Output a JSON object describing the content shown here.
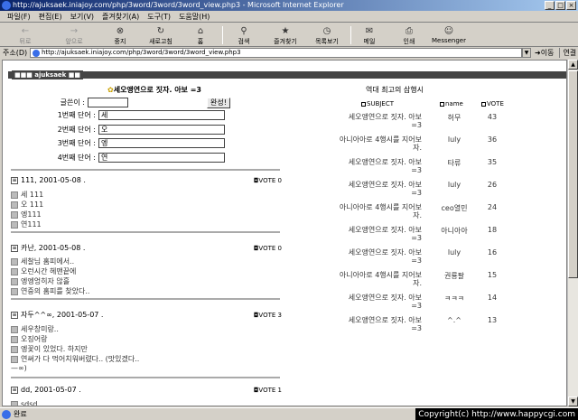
{
  "window": {
    "title": "http://ajuksaek.iniajoy.com/php/3word/3word/3word_view.php3 - Microsoft Internet Explorer"
  },
  "menu": [
    "파일(F)",
    "편집(E)",
    "보기(V)",
    "즐겨찾기(A)",
    "도구(T)",
    "도움말(H)"
  ],
  "toolbar": {
    "back": "뒤로",
    "forward": "앞으로",
    "stop": "중지",
    "refresh": "새로고침",
    "home": "홈",
    "search": "검색",
    "favorites": "즐겨찾기",
    "history": "목록보기",
    "mail": "메일",
    "print": "인쇄",
    "messenger": "Messenger"
  },
  "address": {
    "label": "주소(D)",
    "url": "http://ajuksaek.iniajoy.com/php/3word/3word/3word_view.php3",
    "go": "이동",
    "links": "연결"
  },
  "page": {
    "brand": "ajuksaek",
    "title": "세오앵연으로 짓자. 아보 =3",
    "form": {
      "author_label": "글쓴이 :",
      "author_value": "",
      "word1_label": "1번째 단어 :",
      "word1_value": "세",
      "word2_label": "2번째 단어 :",
      "word2_value": "오",
      "word3_label": "3번째 단어 :",
      "word3_value": "엥",
      "word4_label": "4번째 단어 :",
      "word4_value": "연",
      "submit": "완성!"
    },
    "entries": [
      {
        "header": "111, 2001-05-08 .",
        "vote_label": "VOTE",
        "votes": "0",
        "lines": [
          "세 111",
          "오 111",
          "엥111",
          "연111"
        ]
      },
      {
        "header": "카난, 2001-05-08 .",
        "vote_label": "VOTE",
        "votes": "0",
        "lines": [
          "세찰님 홈피에서..",
          "오런시간 헤맨끝에",
          "엥엥엉히자 않흘",
          "연중의 홈피를 찾았다.."
        ]
      },
      {
        "header": "자두^^∞, 2001-05-07 .",
        "vote_label": "VOTE",
        "votes": "3",
        "lines": [
          "세우창미랑..",
          "오징어랑",
          "엥꽃이 있었다. 하지만",
          "연써가 다 먹어치워버렸다.. (맛있겠다..",
          "—∞)"
        ]
      },
      {
        "header": "dd, 2001-05-07 .",
        "vote_label": "VOTE",
        "votes": "1",
        "lines": [
          "sdsd"
        ]
      }
    ],
    "ranking": {
      "title": "역대 최고의 삼행시",
      "headers": {
        "subject": "SUBJECT",
        "name": "name",
        "vote": "VOTE"
      },
      "rows": [
        {
          "subject": "세오앵연으로 짓자. 아보 =3",
          "name": "허무",
          "vote": "43"
        },
        {
          "subject": "아니아아로 4행시를 지어보자.",
          "name": "luly",
          "vote": "36"
        },
        {
          "subject": "세오앵연으로 짓자. 아보 =3",
          "name": "타류",
          "vote": "35"
        },
        {
          "subject": "세오앵연으로 짓자. 아보 =3",
          "name": "luly",
          "vote": "26"
        },
        {
          "subject": "아니아아로 4행시를 지어보자.",
          "name": "ceo열민",
          "vote": "24"
        },
        {
          "subject": "세오앵연으로 짓자. 아보 =3",
          "name": "아니아아",
          "vote": "18"
        },
        {
          "subject": "세오앵연으로 짓자. 아보 =3",
          "name": "luly",
          "vote": "16"
        },
        {
          "subject": "아니아아로 4행시를 지어보자.",
          "name": "권룡팔",
          "vote": "15"
        },
        {
          "subject": "세오앵연으로 짓자. 아보 =3",
          "name": "ㅋㅋㅋ",
          "vote": "14"
        },
        {
          "subject": "세오앵연으로 짓자. 아보 =3",
          "name": "^.^",
          "vote": "13"
        }
      ]
    }
  },
  "status": {
    "text": "완료",
    "copyright": "Copyright(c) http://www.happycgi.com"
  }
}
